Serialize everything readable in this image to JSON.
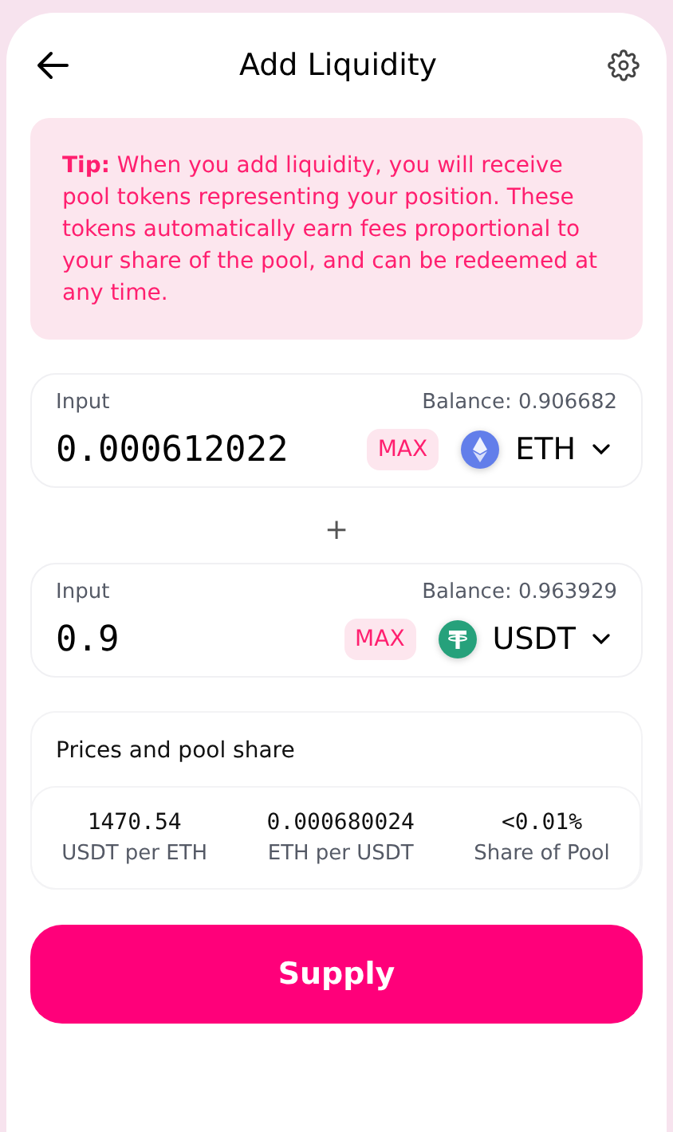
{
  "header": {
    "title": "Add Liquidity"
  },
  "tip": "**Tip:** When you add liquidity, you will receive pool tokens representing your position. These tokens automatically earn fees proportional to your share of the pool, and can be redeemed at any time.",
  "inputs": [
    {
      "label": "Input",
      "balance": "Balance: 0.906682",
      "value": "0.000612022",
      "max": "MAX",
      "token": {
        "kind": "eth",
        "symbol": "ETH"
      }
    },
    {
      "label": "Input",
      "balance": "Balance: 0.963929",
      "value": "0.9",
      "max": "MAX",
      "token": {
        "kind": "usdt",
        "symbol": "USDT"
      }
    }
  ],
  "separator": "+",
  "prices": {
    "title": "Prices and pool share",
    "stats": [
      {
        "value": "1470.54",
        "label": "USDT per ETH"
      },
      {
        "value": "0.000680024",
        "label": "ETH per USDT"
      },
      {
        "value": "<0.01%",
        "label": "Share of Pool"
      }
    ]
  },
  "supply_button": "Supply"
}
